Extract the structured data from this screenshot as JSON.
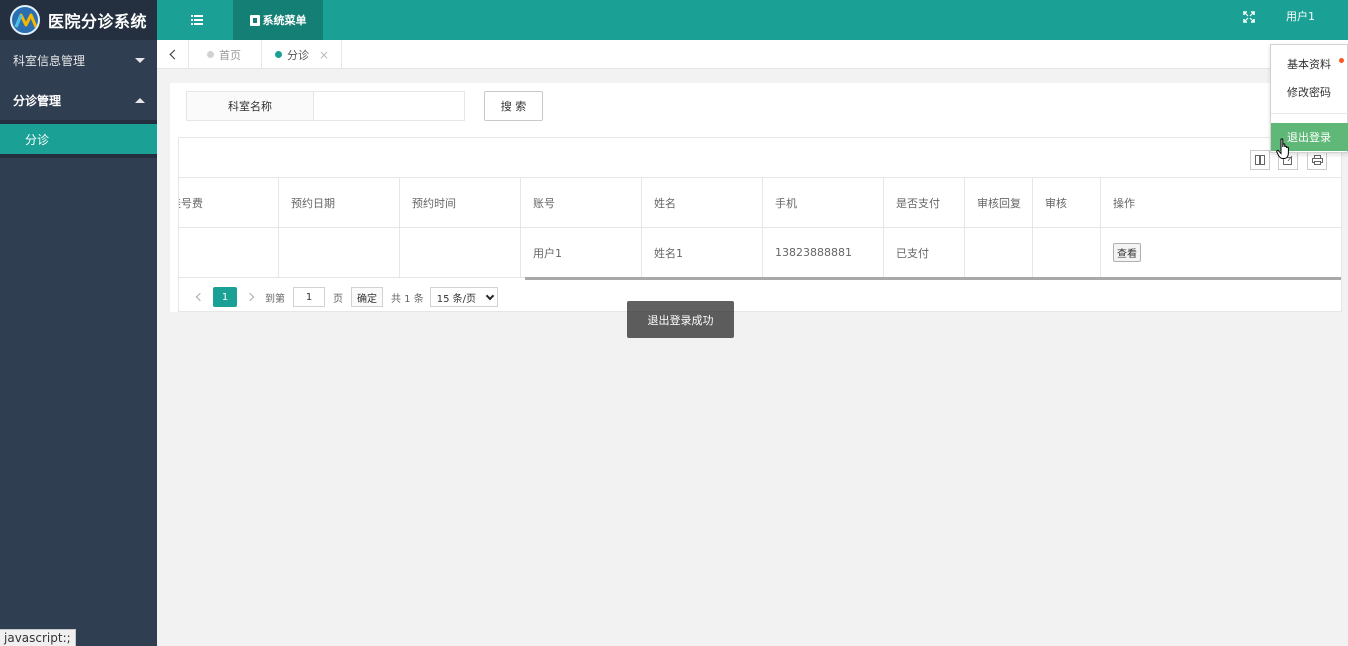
{
  "app": {
    "title": "医院分诊系统"
  },
  "sidebar": {
    "items": [
      {
        "label": "科室信息管理",
        "open": false
      },
      {
        "label": "分诊管理",
        "open": true,
        "children": [
          {
            "label": "分诊",
            "active": true
          }
        ]
      }
    ]
  },
  "topbar": {
    "menu_icon": "list-icon",
    "tab_label": "系统菜单",
    "fullscreen_icon": "fullscreen-icon",
    "user": "用户1"
  },
  "tabs": [
    {
      "label": "首页",
      "active": false
    },
    {
      "label": "分诊",
      "active": true,
      "close": "×"
    }
  ],
  "search": {
    "label": "科室名称",
    "value": "",
    "button": "搜 索"
  },
  "table": {
    "toolbar_icons": [
      "columns-icon",
      "export-icon",
      "print-icon"
    ],
    "columns": [
      "挂号费",
      "预约日期",
      "预约时间",
      "账号",
      "姓名",
      "手机",
      "是否支付",
      "审核回复",
      "审核",
      "操作"
    ],
    "rows": [
      {
        "fee": "",
        "date": "",
        "time": "",
        "account": "用户1",
        "name": "姓名1",
        "phone": "13823888881",
        "paid": "已支付",
        "reply": "",
        "audit": "",
        "action": "查看"
      }
    ]
  },
  "pager": {
    "current": "1",
    "goto_label": "到第",
    "goto_value": "1",
    "page_unit": "页",
    "confirm": "确定",
    "total": "共 1 条",
    "page_size": "15 条/页"
  },
  "toast": "退出登录成功",
  "dropdown": {
    "items": [
      "基本资料",
      "修改密码",
      "退出登录"
    ]
  },
  "status_bar": "javascript:;",
  "colors": {
    "accent": "#1aa094",
    "sidebar": "#2f3e51",
    "logout_active": "#5fb878"
  }
}
